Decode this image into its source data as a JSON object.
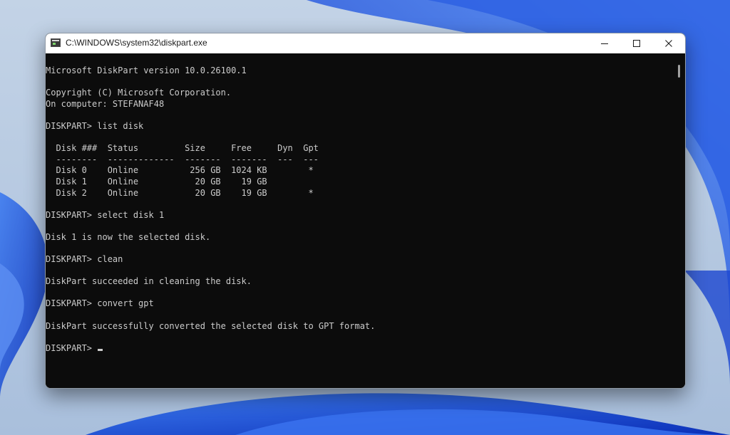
{
  "window": {
    "title": "C:\\WINDOWS\\system32\\diskpart.exe",
    "controls": {
      "minimize_icon": "minimize-icon",
      "maximize_icon": "maximize-icon",
      "close_icon": "close-icon"
    }
  },
  "console": {
    "lines": [
      "Microsoft DiskPart version 10.0.26100.1",
      "",
      "Copyright (C) Microsoft Corporation.",
      "On computer: STEFANAF48",
      "",
      "DISKPART> list disk",
      "",
      "  Disk ###  Status         Size     Free     Dyn  Gpt",
      "  --------  -------------  -------  -------  ---  ---",
      "  Disk 0    Online          256 GB  1024 KB        *",
      "  Disk 1    Online           20 GB    19 GB",
      "  Disk 2    Online           20 GB    19 GB        *",
      "",
      "DISKPART> select disk 1",
      "",
      "Disk 1 is now the selected disk.",
      "",
      "DISKPART> clean",
      "",
      "DiskPart succeeded in cleaning the disk.",
      "",
      "DISKPART> convert gpt",
      "",
      "DiskPart successfully converted the selected disk to GPT format.",
      "",
      "DISKPART> "
    ]
  },
  "colors": {
    "console_bg": "#0c0c0c",
    "console_text": "#cccccc",
    "titlebar_bg": "#ffffff",
    "wallpaper_base": "#9fb8d6",
    "wallpaper_accent": "#1f4fd6"
  }
}
